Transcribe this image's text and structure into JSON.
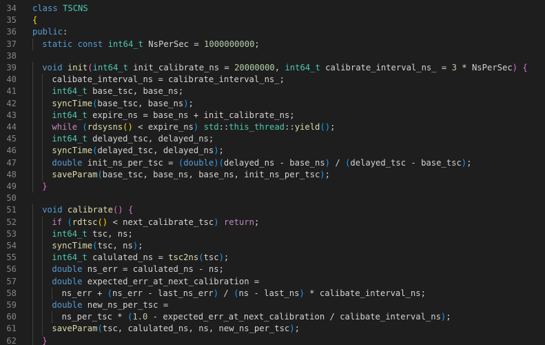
{
  "editor": {
    "language": "cpp",
    "theme_colors": {
      "background": "#1e1e1e",
      "line_number": "#858585",
      "keyword": "#569cd6",
      "control": "#c586c0",
      "type": "#4ec9b0",
      "function": "#dcdcaa",
      "number": "#b5cea8",
      "text": "#d4d4d4",
      "bracket_1": "#ffd700",
      "bracket_2": "#da70d6",
      "bracket_3": "#179fff"
    },
    "lines": [
      {
        "n": "34",
        "indent": 0,
        "tokens": [
          [
            "kw",
            "class"
          ],
          [
            "id",
            " "
          ],
          [
            "ty",
            "TSCNS"
          ]
        ]
      },
      {
        "n": "35",
        "indent": 0,
        "tokens": [
          [
            "br1",
            "{"
          ]
        ]
      },
      {
        "n": "36",
        "indent": 0,
        "tokens": [
          [
            "kw",
            "public"
          ],
          [
            "id",
            ":"
          ]
        ]
      },
      {
        "n": "37",
        "indent": 1,
        "tokens": [
          [
            "kw",
            "static"
          ],
          [
            "id",
            " "
          ],
          [
            "kw",
            "const"
          ],
          [
            "id",
            " "
          ],
          [
            "ty",
            "int64_t"
          ],
          [
            "id",
            " NsPerSec = "
          ],
          [
            "num",
            "1000000000"
          ],
          [
            "id",
            ";"
          ]
        ]
      },
      {
        "n": "38",
        "indent": 0,
        "tokens": []
      },
      {
        "n": "39",
        "indent": 1,
        "tokens": [
          [
            "kw",
            "void"
          ],
          [
            "id",
            " "
          ],
          [
            "fn",
            "init"
          ],
          [
            "br2",
            "("
          ],
          [
            "ty",
            "int64_t"
          ],
          [
            "id",
            " init_calibrate_ns = "
          ],
          [
            "num",
            "20000000"
          ],
          [
            "id",
            ", "
          ],
          [
            "ty",
            "int64_t"
          ],
          [
            "id",
            " calibrate_interval_ns_ = "
          ],
          [
            "num",
            "3"
          ],
          [
            "id",
            " * NsPerSec"
          ],
          [
            "br2",
            ")"
          ],
          [
            "id",
            " "
          ],
          [
            "br2",
            "{"
          ]
        ]
      },
      {
        "n": "40",
        "indent": 2,
        "tokens": [
          [
            "id",
            "calibate_interval_ns = calibrate_interval_ns_;"
          ]
        ]
      },
      {
        "n": "41",
        "indent": 2,
        "tokens": [
          [
            "ty",
            "int64_t"
          ],
          [
            "id",
            " base_tsc, base_ns;"
          ]
        ]
      },
      {
        "n": "42",
        "indent": 2,
        "tokens": [
          [
            "fn",
            "syncTime"
          ],
          [
            "br3",
            "("
          ],
          [
            "id",
            "base_tsc, base_ns"
          ],
          [
            "br3",
            ")"
          ],
          [
            "id",
            ";"
          ]
        ]
      },
      {
        "n": "43",
        "indent": 2,
        "tokens": [
          [
            "ty",
            "int64_t"
          ],
          [
            "id",
            " expire_ns = base_ns + init_calibrate_ns;"
          ]
        ]
      },
      {
        "n": "44",
        "indent": 2,
        "tokens": [
          [
            "ctl",
            "while"
          ],
          [
            "id",
            " "
          ],
          [
            "br3",
            "("
          ],
          [
            "fn",
            "rdsysns"
          ],
          [
            "br1",
            "()"
          ],
          [
            "id",
            " < expire_ns"
          ],
          [
            "br3",
            ")"
          ],
          [
            "id",
            " "
          ],
          [
            "ty",
            "std"
          ],
          [
            "id",
            "::"
          ],
          [
            "ty",
            "this_thread"
          ],
          [
            "id",
            "::"
          ],
          [
            "fn",
            "yield"
          ],
          [
            "br3",
            "()"
          ],
          [
            "id",
            ";"
          ]
        ]
      },
      {
        "n": "45",
        "indent": 2,
        "tokens": [
          [
            "ty",
            "int64_t"
          ],
          [
            "id",
            " delayed_tsc, delayed_ns;"
          ]
        ]
      },
      {
        "n": "46",
        "indent": 2,
        "tokens": [
          [
            "fn",
            "syncTime"
          ],
          [
            "br3",
            "("
          ],
          [
            "id",
            "delayed_tsc, delayed_ns"
          ],
          [
            "br3",
            ")"
          ],
          [
            "id",
            ";"
          ]
        ]
      },
      {
        "n": "47",
        "indent": 2,
        "tokens": [
          [
            "kw",
            "double"
          ],
          [
            "id",
            " init_ns_per_tsc = "
          ],
          [
            "br3",
            "("
          ],
          [
            "kw",
            "double"
          ],
          [
            "br3",
            ")"
          ],
          [
            "br3",
            "("
          ],
          [
            "id",
            "delayed_ns - base_ns"
          ],
          [
            "br3",
            ")"
          ],
          [
            "id",
            " / "
          ],
          [
            "br3",
            "("
          ],
          [
            "id",
            "delayed_tsc - base_tsc"
          ],
          [
            "br3",
            ")"
          ],
          [
            "id",
            ";"
          ]
        ]
      },
      {
        "n": "48",
        "indent": 2,
        "tokens": [
          [
            "fn",
            "saveParam"
          ],
          [
            "br3",
            "("
          ],
          [
            "id",
            "base_tsc, base_ns, base_ns, init_ns_per_tsc"
          ],
          [
            "br3",
            ")"
          ],
          [
            "id",
            ";"
          ]
        ]
      },
      {
        "n": "49",
        "indent": 1,
        "tokens": [
          [
            "br2",
            "}"
          ]
        ]
      },
      {
        "n": "50",
        "indent": 0,
        "tokens": []
      },
      {
        "n": "51",
        "indent": 1,
        "tokens": [
          [
            "kw",
            "void"
          ],
          [
            "id",
            " "
          ],
          [
            "fn",
            "calibrate"
          ],
          [
            "br2",
            "()"
          ],
          [
            "id",
            " "
          ],
          [
            "br2",
            "{"
          ]
        ]
      },
      {
        "n": "52",
        "indent": 2,
        "tokens": [
          [
            "ctl",
            "if"
          ],
          [
            "id",
            " "
          ],
          [
            "br3",
            "("
          ],
          [
            "fn",
            "rdtsc"
          ],
          [
            "br1",
            "()"
          ],
          [
            "id",
            " < next_calibrate_tsc"
          ],
          [
            "br3",
            ")"
          ],
          [
            "id",
            " "
          ],
          [
            "ctl",
            "return"
          ],
          [
            "id",
            ";"
          ]
        ]
      },
      {
        "n": "53",
        "indent": 2,
        "tokens": [
          [
            "ty",
            "int64_t"
          ],
          [
            "id",
            " tsc, ns;"
          ]
        ]
      },
      {
        "n": "54",
        "indent": 2,
        "tokens": [
          [
            "fn",
            "syncTime"
          ],
          [
            "br3",
            "("
          ],
          [
            "id",
            "tsc, ns"
          ],
          [
            "br3",
            ")"
          ],
          [
            "id",
            ";"
          ]
        ]
      },
      {
        "n": "55",
        "indent": 2,
        "tokens": [
          [
            "ty",
            "int64_t"
          ],
          [
            "id",
            " calulated_ns = "
          ],
          [
            "fn",
            "tsc2ns"
          ],
          [
            "br3",
            "("
          ],
          [
            "id",
            "tsc"
          ],
          [
            "br3",
            ")"
          ],
          [
            "id",
            ";"
          ]
        ]
      },
      {
        "n": "56",
        "indent": 2,
        "tokens": [
          [
            "kw",
            "double"
          ],
          [
            "id",
            " ns_err = calulated_ns - ns;"
          ]
        ]
      },
      {
        "n": "57",
        "indent": 2,
        "tokens": [
          [
            "kw",
            "double"
          ],
          [
            "id",
            " expected_err_at_next_calibration ="
          ]
        ]
      },
      {
        "n": "58",
        "indent": 3,
        "tokens": [
          [
            "id",
            "ns_err + "
          ],
          [
            "br3",
            "("
          ],
          [
            "id",
            "ns_err - last_ns_err"
          ],
          [
            "br3",
            ")"
          ],
          [
            "id",
            " / "
          ],
          [
            "br3",
            "("
          ],
          [
            "id",
            "ns - last_ns"
          ],
          [
            "br3",
            ")"
          ],
          [
            "id",
            " * calibate_interval_ns;"
          ]
        ]
      },
      {
        "n": "59",
        "indent": 2,
        "tokens": [
          [
            "kw",
            "double"
          ],
          [
            "id",
            " new_ns_per_tsc ="
          ]
        ]
      },
      {
        "n": "60",
        "indent": 3,
        "tokens": [
          [
            "id",
            "ns_per_tsc * "
          ],
          [
            "br3",
            "("
          ],
          [
            "num",
            "1.0"
          ],
          [
            "id",
            " - expected_err_at_next_calibration / calibate_interval_ns"
          ],
          [
            "br3",
            ")"
          ],
          [
            "id",
            ";"
          ]
        ]
      },
      {
        "n": "61",
        "indent": 2,
        "tokens": [
          [
            "fn",
            "saveParam"
          ],
          [
            "br3",
            "("
          ],
          [
            "id",
            "tsc, calulated_ns, ns, new_ns_per_tsc"
          ],
          [
            "br3",
            ")"
          ],
          [
            "id",
            ";"
          ]
        ]
      },
      {
        "n": "62",
        "indent": 1,
        "tokens": [
          [
            "br2",
            "}"
          ]
        ]
      }
    ]
  }
}
